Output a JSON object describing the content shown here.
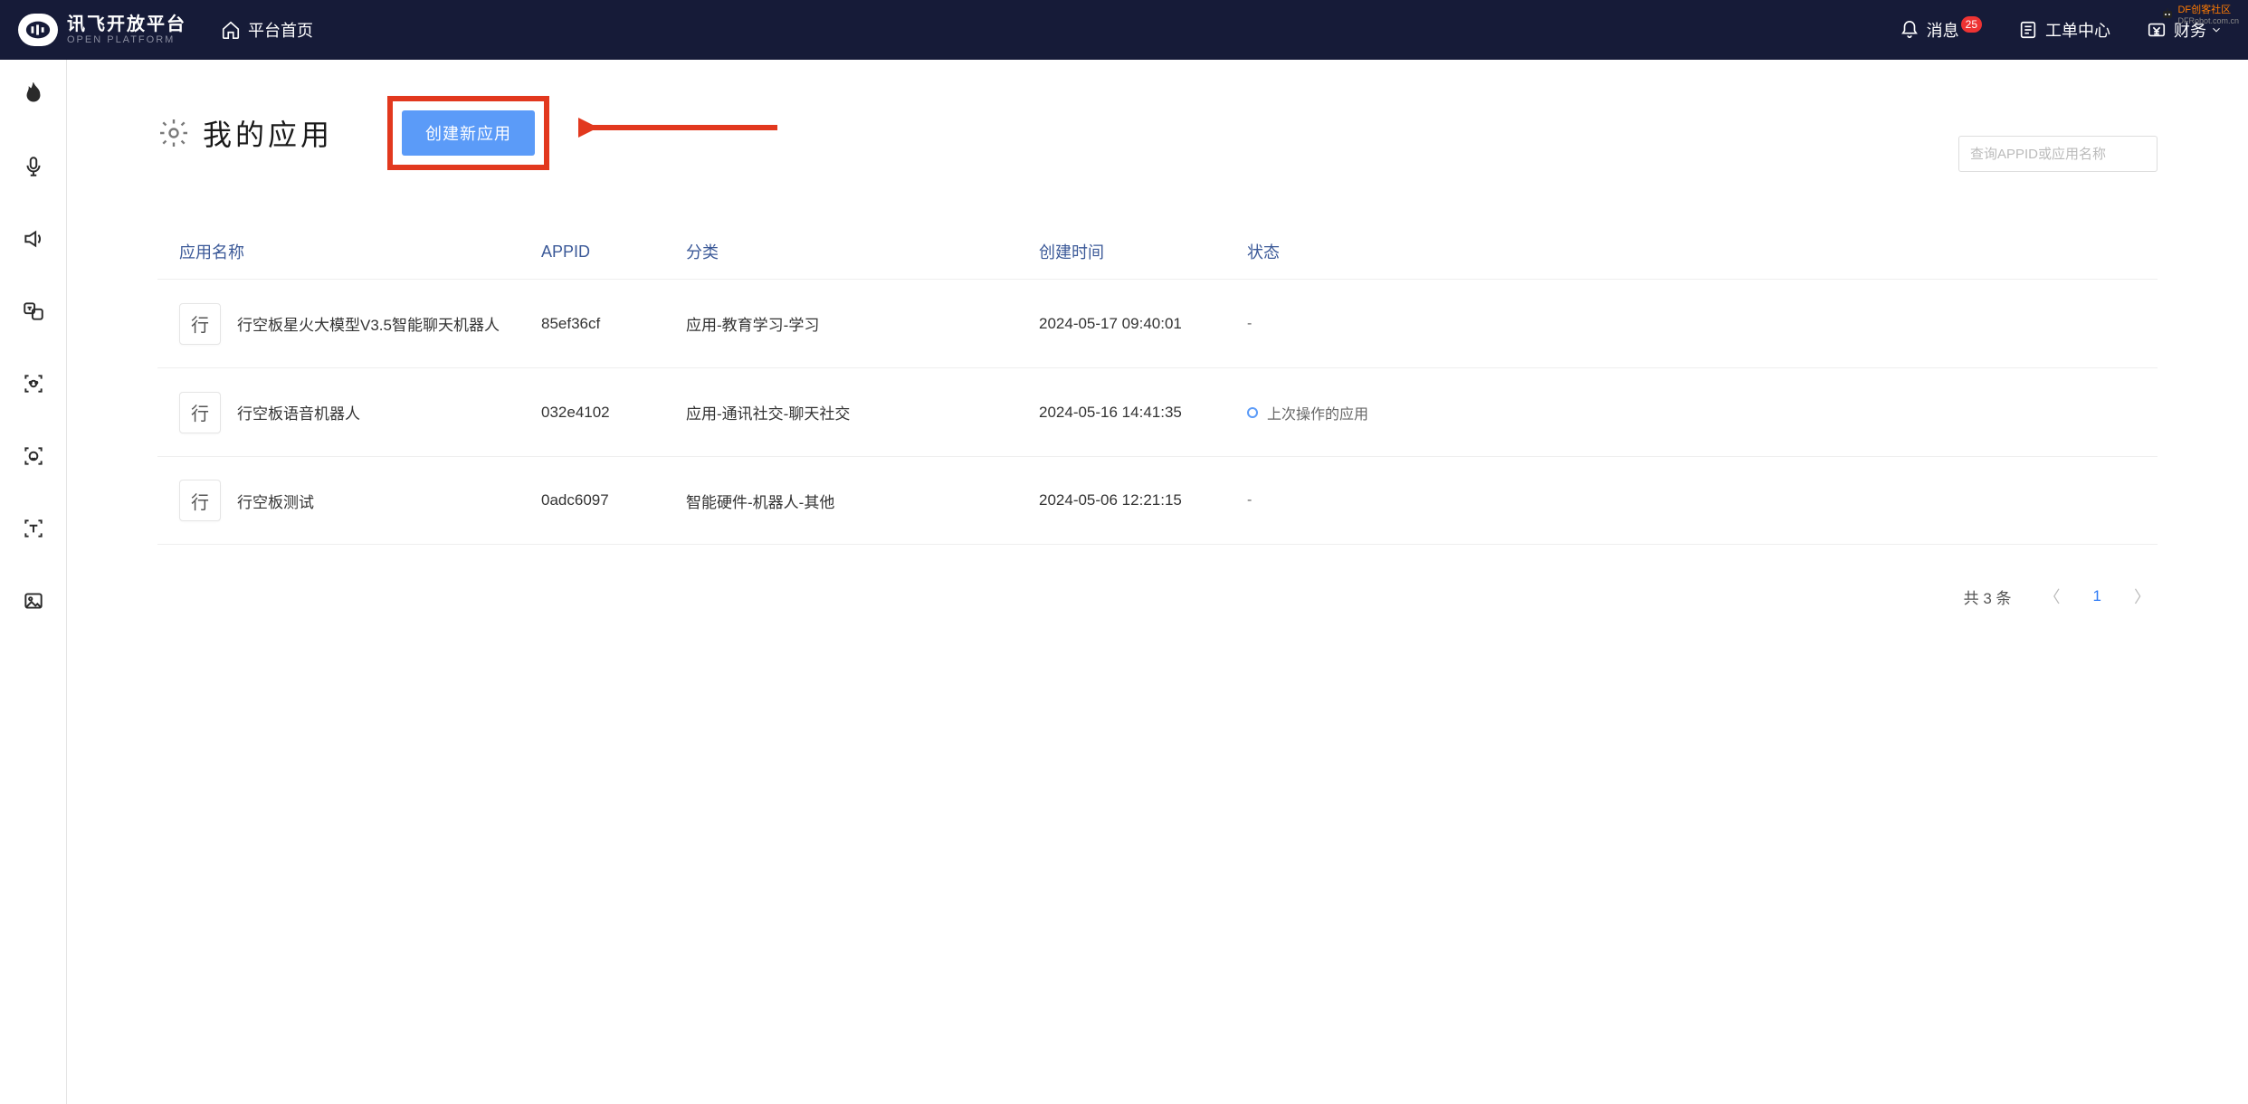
{
  "header": {
    "logo_main": "讯飞开放平台",
    "logo_sub": "OPEN PLATFORM",
    "home_label": "平台首页",
    "messages_label": "消息",
    "messages_badge": "25",
    "tickets_label": "工单中心",
    "finance_label": "财务",
    "corner_brand": "DF创客社区",
    "corner_brand_sub": "DFRobot.com.cn"
  },
  "page": {
    "title": "我的应用",
    "create_button": "创建新应用",
    "search_placeholder": "查询APPID或应用名称"
  },
  "table": {
    "columns": {
      "name": "应用名称",
      "appid": "APPID",
      "category": "分类",
      "created": "创建时间",
      "status": "状态"
    },
    "rows": [
      {
        "badge": "行",
        "name": "行空板星火大模型V3.5智能聊天机器人",
        "appid": "85ef36cf",
        "category": "应用-教育学习-学习",
        "created": "2024-05-17 09:40:01",
        "status": "-"
      },
      {
        "badge": "行",
        "name": "行空板语音机器人",
        "appid": "032e4102",
        "category": "应用-通讯社交-聊天社交",
        "created": "2024-05-16 14:41:35",
        "status": "上次操作的应用",
        "status_dot": true
      },
      {
        "badge": "行",
        "name": "行空板测试",
        "appid": "0adc6097",
        "category": "智能硬件-机器人-其他",
        "created": "2024-05-06 12:21:15",
        "status": "-"
      }
    ]
  },
  "pagination": {
    "total_text": "共 3 条",
    "page_number": "1"
  }
}
